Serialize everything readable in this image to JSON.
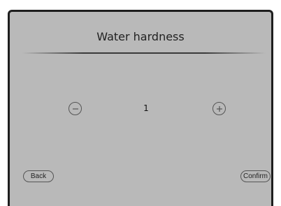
{
  "screen": {
    "title": "Water hardness",
    "value": "1"
  },
  "controls": {
    "decrement_icon": "minus-circle-icon",
    "increment_icon": "plus-circle-icon",
    "back_label": "Back",
    "confirm_label": "Confirm"
  },
  "colors": {
    "background": "#b9b9b9",
    "frame": "#1e1e1e",
    "text": "#222222"
  }
}
